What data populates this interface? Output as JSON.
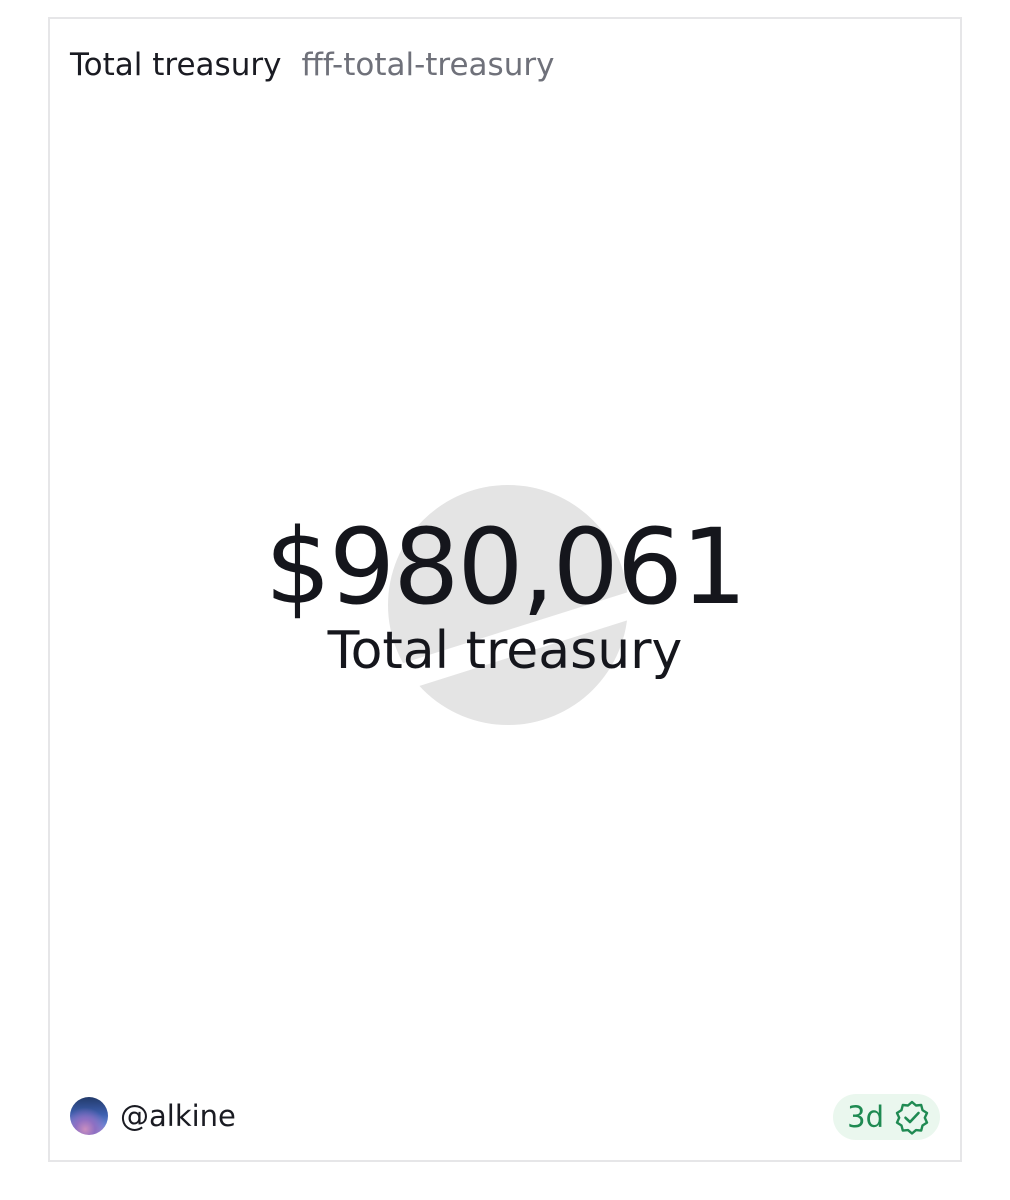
{
  "card": {
    "title": "Total treasury",
    "slug": "fff-total-treasury"
  },
  "metric": {
    "value": "$980,061",
    "label": "Total treasury"
  },
  "footer": {
    "username": "@alkine",
    "age": "3d"
  },
  "icons": {
    "watermark": "logo-watermark-icon",
    "verified": "verified-check-icon",
    "avatar": "user-avatar"
  },
  "colors": {
    "text": "#15161c",
    "muted": "#6f717a",
    "border": "#e6e6e8",
    "badge_bg": "#eaf7ee",
    "badge_fg": "#1f8a52",
    "watermark": "#e4e4e4"
  }
}
